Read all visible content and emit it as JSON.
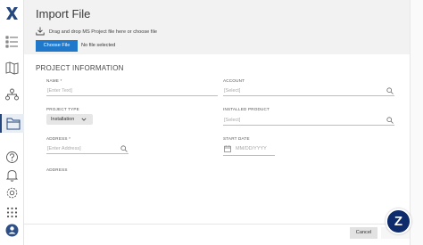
{
  "colors": {
    "brand": "#25477d",
    "primary_button": "#1f78c9",
    "fab": "#0e2b6b"
  },
  "rail": {
    "logo": "X",
    "icons": [
      "list-icon",
      "map-icon",
      "org-chart-icon",
      "folder-icon",
      "help-icon",
      "bell-icon",
      "settings-icon",
      "apps-grid-icon",
      "user-icon"
    ]
  },
  "header": {
    "title": "Import File",
    "drop_text": "Drag and drop MS Project file here or choose file",
    "choose_label": "Choose File",
    "no_file": "No file selected"
  },
  "form": {
    "section_title": "PROJECT INFORMATION",
    "name_label": "NAME *",
    "name_placeholder": "[Enter Text]",
    "account_label": "ACCOUNT",
    "account_placeholder": "[Select]",
    "project_type_label": "PROJECT TYPE",
    "project_type_value": "Installation",
    "installed_product_label": "INSTALLED PRODUCT",
    "installed_product_placeholder": "[Select]",
    "address_label": "ADDRESS *",
    "address_placeholder": "[Enter Address]",
    "start_date_label": "START DATE",
    "start_date_placeholder": "MM/DD/YYYY",
    "address2_label": "ADDRESS"
  },
  "footer": {
    "cancel_label": "Cancel",
    "fab_label": "Z"
  }
}
